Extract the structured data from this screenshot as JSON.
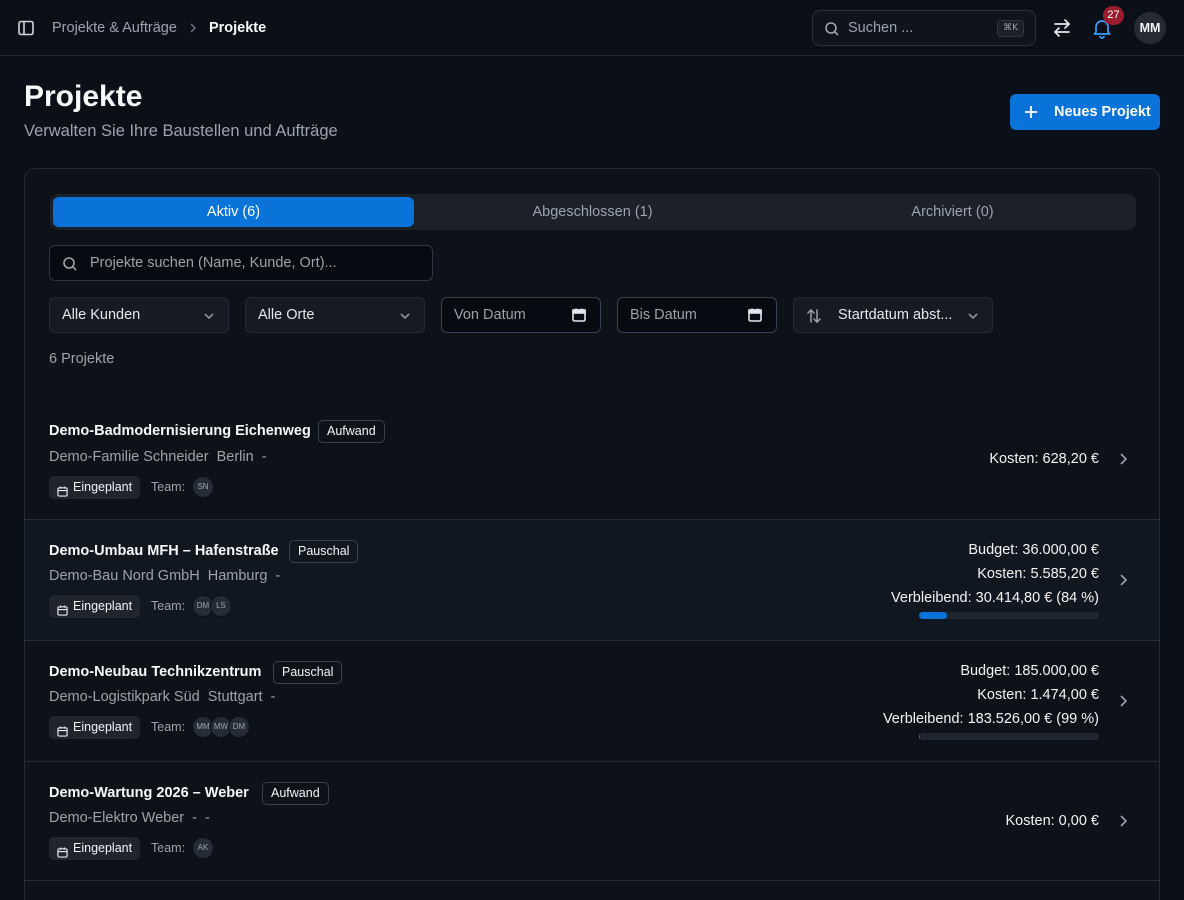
{
  "breadcrumb": {
    "parent": "Projekte & Aufträge",
    "current": "Projekte"
  },
  "search": {
    "placeholder": "Suchen ...",
    "shortcut": "⌘K"
  },
  "notifications": {
    "count": "27"
  },
  "user": {
    "initials": "MM"
  },
  "header": {
    "title": "Projekte",
    "subtitle": "Verwalten Sie Ihre Baustellen und Aufträge",
    "new_button": "Neues Projekt"
  },
  "tabs": [
    {
      "label": "Aktiv (6)",
      "active": true
    },
    {
      "label": "Abgeschlossen (1)",
      "active": false
    },
    {
      "label": "Archiviert (0)",
      "active": false
    }
  ],
  "filters": {
    "search_placeholder": "Projekte suchen (Name, Kunde, Ort)...",
    "customer": "Alle Kunden",
    "location": "Alle Orte",
    "from_date": "Von Datum",
    "to_date": "Bis Datum",
    "sort": "Startdatum abst..."
  },
  "project_count": "6 Projekte",
  "colors": {
    "accent": "#0a73d9",
    "badge": "#9b1c2c",
    "background": "#0b0f17"
  },
  "projects": [
    {
      "name": "Demo-Badmodernisierung Eichenweg",
      "type": "Aufwand",
      "client_line": "Demo-Familie Schneider  Berlin  -",
      "status": "Eingeplant",
      "team_label": "Team:",
      "team": [
        "SN"
      ],
      "money": [
        "Kosten: 628,20 €"
      ]
    },
    {
      "name": "Demo-Umbau MFH – Hafenstraße",
      "type": "Pauschal",
      "client_line": "Demo-Bau Nord GmbH  Hamburg  -",
      "status": "Eingeplant",
      "team_label": "Team:",
      "team": [
        "DM",
        "LS"
      ],
      "money": [
        "Budget: 36.000,00 €",
        "Kosten: 5.585,20 €",
        "Verbleibend: 30.414,80 € (84 %)"
      ],
      "used_fraction": 0.155
    },
    {
      "name": "Demo-Neubau Technikzentrum",
      "type": "Pauschal",
      "client_line": "Demo-Logistikpark Süd  Stuttgart  -",
      "status": "Eingeplant",
      "team_label": "Team:",
      "team": [
        "MM",
        "MW",
        "DM"
      ],
      "money": [
        "Budget: 185.000,00 €",
        "Kosten: 1.474,00 €",
        "Verbleibend: 183.526,00 € (99 %)"
      ],
      "used_fraction": 0.008
    },
    {
      "name": "Demo-Wartung 2026 – Weber",
      "type": "Aufwand",
      "client_line": "Demo-Elektro Weber  -  -",
      "status": "Eingeplant",
      "team_label": "Team:",
      "team": [
        "AK"
      ],
      "money": [
        "Kosten: 0,00 €"
      ]
    }
  ]
}
